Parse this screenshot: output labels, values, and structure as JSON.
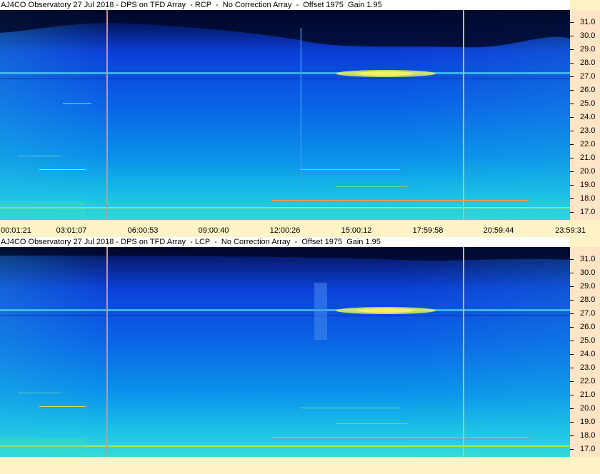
{
  "panels": [
    {
      "title": "AJ4CO Observatory 27 Jul 2018 - DPS on TFD Array  - RCP  -  No Correction Array  -  Offset 1975  Gain 1.95"
    },
    {
      "title": "AJ4CO Observatory 27 Jul 2018 - DPS on TFD Array  - LCP  -  No Correction Array  -  Offset 1975  Gain 1.95"
    }
  ],
  "freq_labels": [
    "31.0",
    "30.0",
    "29.0",
    "28.0",
    "27.0",
    "26.0",
    "25.0",
    "24.0",
    "23.0",
    "22.0",
    "21.0",
    "20.0",
    "19.0",
    "18.0",
    "17.0"
  ],
  "time_labels": [
    "00:01:21",
    "03:01:07",
    "06:00:53",
    "09:00:40",
    "12:00:26",
    "15:00:12",
    "17:59:58",
    "20:59:44",
    "23:59:31"
  ],
  "colors": {
    "low": "#1040e0",
    "mid": "#0a7ae8",
    "high": "#28d8e8",
    "hot": "#f0f040",
    "marker_left": "#d08080",
    "marker_right": "#e0c040",
    "axis_bg": "#ffe4c6",
    "time_bg": "#fdf3c6"
  }
}
